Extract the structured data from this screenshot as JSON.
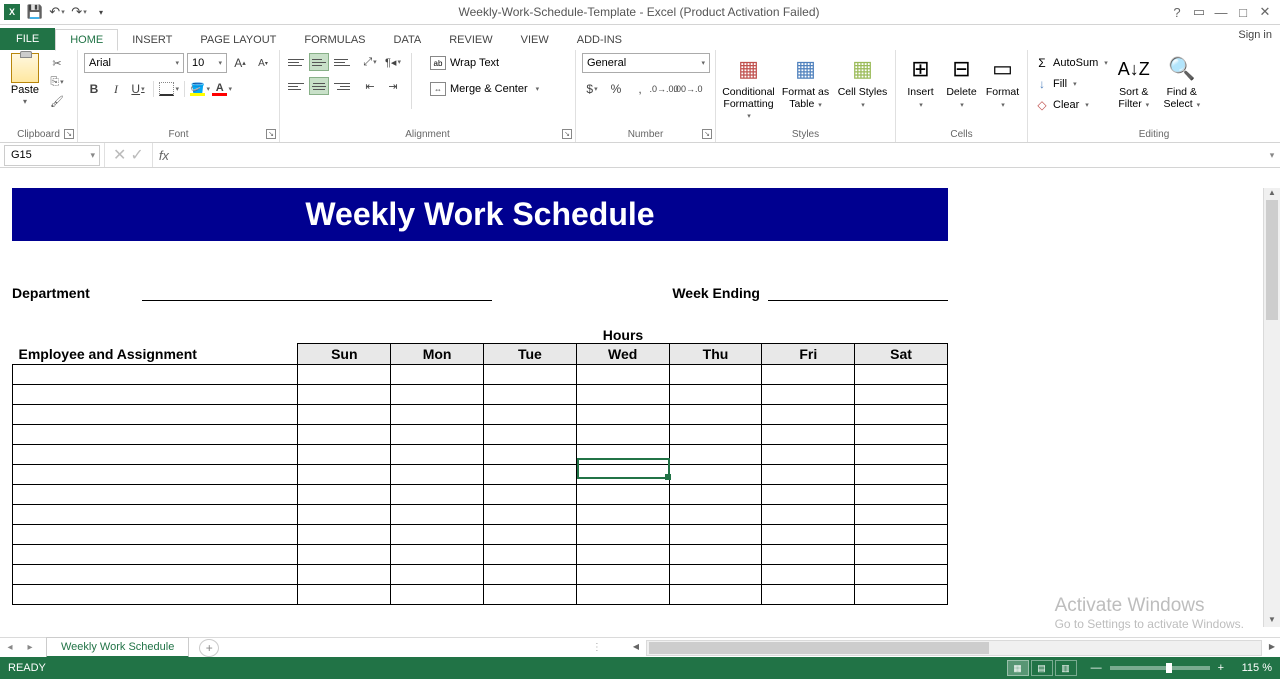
{
  "titlebar": {
    "title": "Weekly-Work-Schedule-Template - Excel (Product Activation Failed)"
  },
  "tabs": {
    "file": "FILE",
    "home": "HOME",
    "insert": "INSERT",
    "page_layout": "PAGE LAYOUT",
    "formulas": "FORMULAS",
    "data": "DATA",
    "review": "REVIEW",
    "view": "VIEW",
    "addins": "ADD-INS",
    "signin": "Sign in"
  },
  "ribbon": {
    "clipboard": {
      "paste": "Paste",
      "label": "Clipboard"
    },
    "font": {
      "name": "Arial",
      "size": "10",
      "label": "Font"
    },
    "alignment": {
      "wrap": "Wrap Text",
      "merge": "Merge & Center",
      "label": "Alignment"
    },
    "number": {
      "format": "General",
      "label": "Number"
    },
    "styles": {
      "cond": "Conditional Formatting",
      "table": "Format as Table",
      "cell": "Cell Styles",
      "label": "Styles"
    },
    "cells": {
      "insert": "Insert",
      "delete": "Delete",
      "format": "Format",
      "label": "Cells"
    },
    "editing": {
      "autosum": "AutoSum",
      "fill": "Fill",
      "clear": "Clear",
      "sort": "Sort & Filter",
      "find": "Find & Select",
      "label": "Editing"
    }
  },
  "formula_bar": {
    "cell_ref": "G15",
    "formula": ""
  },
  "worksheet": {
    "title": "Weekly Work Schedule",
    "department_label": "Department",
    "week_ending_label": "Week Ending",
    "hours_label": "Hours",
    "emp_header": "Employee and Assignment",
    "days": [
      "Sun",
      "Mon",
      "Tue",
      "Wed",
      "Thu",
      "Fri",
      "Sat"
    ]
  },
  "sheet_tabs": {
    "active": "Weekly Work Schedule"
  },
  "statusbar": {
    "ready": "READY",
    "zoom": "115 %"
  },
  "watermark": {
    "l1": "Activate Windows",
    "l2": "Go to Settings to activate Windows."
  }
}
